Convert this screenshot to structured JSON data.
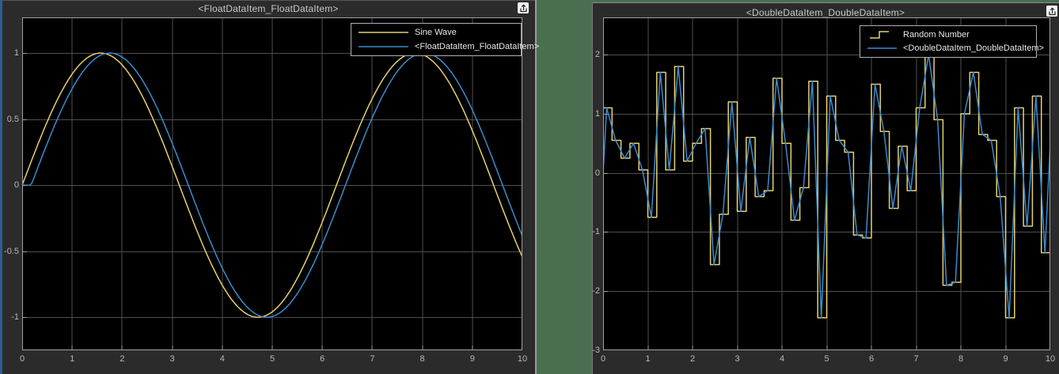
{
  "desktop": {
    "background_color": "#4a6e50"
  },
  "colors": {
    "window_background": "#2b2b2b",
    "axes_background": "#000000",
    "grid": "#4f4f4f",
    "axes_border": "#a0a0a0",
    "tick_label": "#b8b8b8",
    "title_text": "#c8c8c8",
    "legend_text": "#e8e8e8",
    "legend_border": "#b0b0b0",
    "series_yellow": "#e6d06e",
    "series_blue": "#3a8ccc",
    "focus_border_blue": "#2e5c94",
    "window_edge_gray": "#9a9a9a"
  },
  "windows": [
    {
      "title": "<FloatDataItem_FloatDataItem>",
      "popout_icon": "pop-out-window-icon"
    },
    {
      "title": "<DoubleDataItem_DoubleDataItem>",
      "popout_icon": "pop-out-window-icon"
    }
  ],
  "chart_data": [
    {
      "type": "line",
      "title": "<FloatDataItem_FloatDataItem>",
      "xlabel": "",
      "ylabel": "",
      "xlim": [
        0,
        10
      ],
      "ylim": [
        -1.25,
        1.27
      ],
      "x_ticks": [
        0,
        1,
        2,
        3,
        4,
        5,
        6,
        7,
        8,
        9,
        10
      ],
      "y_ticks": [
        -1,
        -0.5,
        0,
        0.5,
        1
      ],
      "grid": true,
      "legend_position": "top-right",
      "series": [
        {
          "name": "Sine Wave",
          "color": "#e6d06e",
          "render": "sine",
          "amplitude": 1,
          "frequency_rad_per_s": 1,
          "delay": 0,
          "sample_x": [
            0,
            0.5,
            1,
            1.5,
            2,
            2.5,
            3,
            3.5,
            4,
            4.5,
            5,
            5.5,
            6,
            6.5,
            7,
            7.5,
            8,
            8.5,
            9,
            9.5,
            10
          ],
          "sample_y": [
            0,
            0.479,
            0.841,
            0.997,
            0.909,
            0.599,
            0.141,
            -0.351,
            -0.757,
            -0.978,
            -0.959,
            -0.706,
            -0.279,
            0.215,
            0.657,
            0.938,
            0.989,
            0.798,
            0.412,
            -0.075,
            -0.544
          ]
        },
        {
          "name": "<FloatDataItem_FloatDataItem>",
          "color": "#3a8ccc",
          "render": "sine",
          "amplitude": 1,
          "frequency_rad_per_s": 1,
          "delay": 0.18,
          "sample_x": [
            0,
            0.5,
            1,
            1.5,
            2,
            2.5,
            3,
            3.5,
            4,
            4.5,
            5,
            5.5,
            6,
            6.5,
            7,
            7.5,
            8,
            8.5,
            9,
            9.5,
            10
          ],
          "sample_y": [
            0,
            0.315,
            0.731,
            0.969,
            0.969,
            0.732,
            0.316,
            -0.177,
            -0.627,
            -0.924,
            -0.994,
            -0.823,
            -0.444,
            0.037,
            0.522,
            0.862,
            0.999,
            0.905,
            0.585,
            0.115,
            -0.375
          ]
        }
      ]
    },
    {
      "type": "line",
      "title": "<DoubleDataItem_DoubleDataItem>",
      "xlabel": "",
      "ylabel": "",
      "xlim": [
        0,
        10
      ],
      "ylim": [
        -3,
        2.63
      ],
      "x_ticks": [
        0,
        1,
        2,
        3,
        4,
        5,
        6,
        7,
        8,
        9,
        10
      ],
      "y_ticks": [
        -3,
        -2,
        -1,
        0,
        1,
        2
      ],
      "grid": true,
      "legend_position": "top-right",
      "sample_time": 0.2,
      "t_start": 0,
      "values": [
        1.1,
        0.55,
        0.25,
        0.5,
        0.05,
        -0.75,
        1.7,
        0.05,
        1.8,
        0.2,
        0.5,
        0.75,
        -1.55,
        -0.7,
        1.2,
        -0.65,
        0.6,
        -0.4,
        -0.3,
        1.6,
        0.5,
        -0.8,
        -0.25,
        1.55,
        -2.45,
        1.3,
        0.55,
        0.35,
        -1.05,
        -1.1,
        1.5,
        0.7,
        -0.6,
        0.45,
        -0.3,
        1.1,
        2.0,
        0.9,
        -1.9,
        -1.85,
        1.0,
        1.7,
        0.65,
        0.55,
        -0.4,
        -2.45,
        1.1,
        -0.9,
        1.3,
        -1.35,
        0.5
      ],
      "series": [
        {
          "name": "Random Number",
          "color": "#e6d06e",
          "render": "stairs",
          "delay": 0
        },
        {
          "name": "<DoubleDataItem_DoubleDataItem>",
          "color": "#3a8ccc",
          "render": "linear",
          "delay": 0.08
        }
      ]
    }
  ]
}
